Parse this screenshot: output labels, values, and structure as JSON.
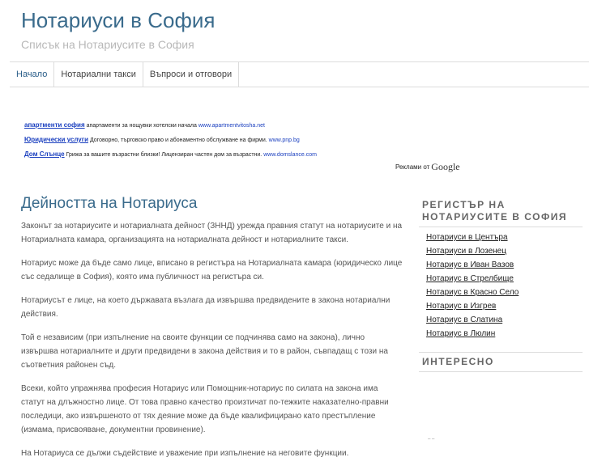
{
  "site": {
    "title": "Нотариуси в София",
    "description": "Списък на Нотариусите в София"
  },
  "nav": [
    {
      "label": "Начало"
    },
    {
      "label": "Нотариални такси"
    },
    {
      "label": "Въпроси и отговори"
    }
  ],
  "ads": [
    {
      "title": "апартменти софия",
      "text": "апартаменти за нощувки хотелски начала",
      "url": "www.apartmentvitosha.net"
    },
    {
      "title": "Юридически услуги",
      "text": "Договорно, търговско право и абонаментно обслужване на фирми.",
      "url": "www.pnp.bg"
    },
    {
      "title": "Дом Слънце",
      "text": "Грижа за вашите възрастни близки! Лицензиран частен дом за възрастни.",
      "url": "www.domslance.com"
    }
  ],
  "ads_by": {
    "text": "Реклами от",
    "logo": "Google"
  },
  "post": {
    "title": "Дейността на Нотариуса",
    "paragraphs": [
      "Законът за нотариусите и нотариалната дейност (ЗННД) урежда правния статут на нотариусите и на Нотариалната камара, организацията на нотариалната дейност и нотариалните такси.",
      "Нотариус може да бъде само лице, вписано в регистъра на Нотариалната камара (юридическо лице със седалище в София), която има публичност на регистъра си.",
      "Нотариусът е лице, на което държавата възлага да извършва предвидените в закона нотариални действия.",
      "Той е независим (при изпълнение на своите функции се подчинява само на закона), лично извършва нотариалните и други предвидени в закона действия и то в район, съвпадащ с този на съответния районен съд.",
      "Всеки, който упражнява професия Нотариус или Помощник-нотариус по силата на закона има статут на длъжностно лице. От това правно качество произтичат по-тежките наказателно-правни последици, ако извършеното от тях деяние може да бъде квалифицирано като престъпление (измама, присвояване, документни провинение).",
      "На Нотариуса се дължи съдействие и уважение при изпълнение на неговите функции."
    ]
  },
  "sidebar": {
    "registry_title": "РЕГИСТЪР НА НОТАРИУСИТЕ В СОФИЯ",
    "links": [
      {
        "label": "Нотариуси в Центъра"
      },
      {
        "label": "Нотариуси в Лозенец"
      },
      {
        "label": "Нотариус в Иван Вазов"
      },
      {
        "label": "Нотариус в Стрелбище"
      },
      {
        "label": "Нотариус в Красно Село"
      },
      {
        "label": "Нотариус в Изгрев"
      },
      {
        "label": "Нотариус в Слатина"
      },
      {
        "label": "Нотариус в Люлин"
      }
    ],
    "interesting_title": "ИНТЕРЕСНО"
  },
  "colors": {
    "title": "#3a6b8c",
    "ad_link": "#1a3fbf",
    "muted": "#b8b8b8"
  }
}
